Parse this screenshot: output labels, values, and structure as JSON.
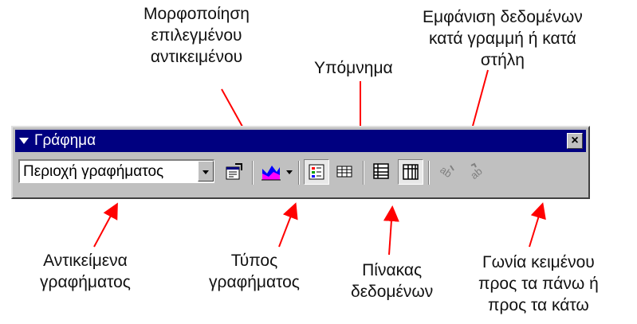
{
  "callouts": {
    "format_object": [
      "Μορφοποίηση",
      "επιλεγμένου",
      "αντικειμένου"
    ],
    "legend": [
      "Υπόμνημα"
    ],
    "by_row_col": [
      "Εμφάνιση δεδομένων",
      "κατά γραμμή ή κατά",
      "στήλη"
    ],
    "chart_objects": [
      "Αντικείμενα",
      "γραφήματος"
    ],
    "chart_type": [
      "Τύπος",
      "γραφήματος"
    ],
    "data_table": [
      "Πίνακας",
      "δεδομένων"
    ],
    "angle_text": [
      "Γωνία κειμένου",
      "προς τα πάνω ή",
      "προς τα κάτω"
    ]
  },
  "toolbar": {
    "title": "Γράφημα",
    "close_label": "×",
    "objects_value": "Περιοχή γραφήματος"
  },
  "colors": {
    "titlebar": "#000080",
    "face": "#c0c0c0",
    "arrow": "#ff0000"
  }
}
